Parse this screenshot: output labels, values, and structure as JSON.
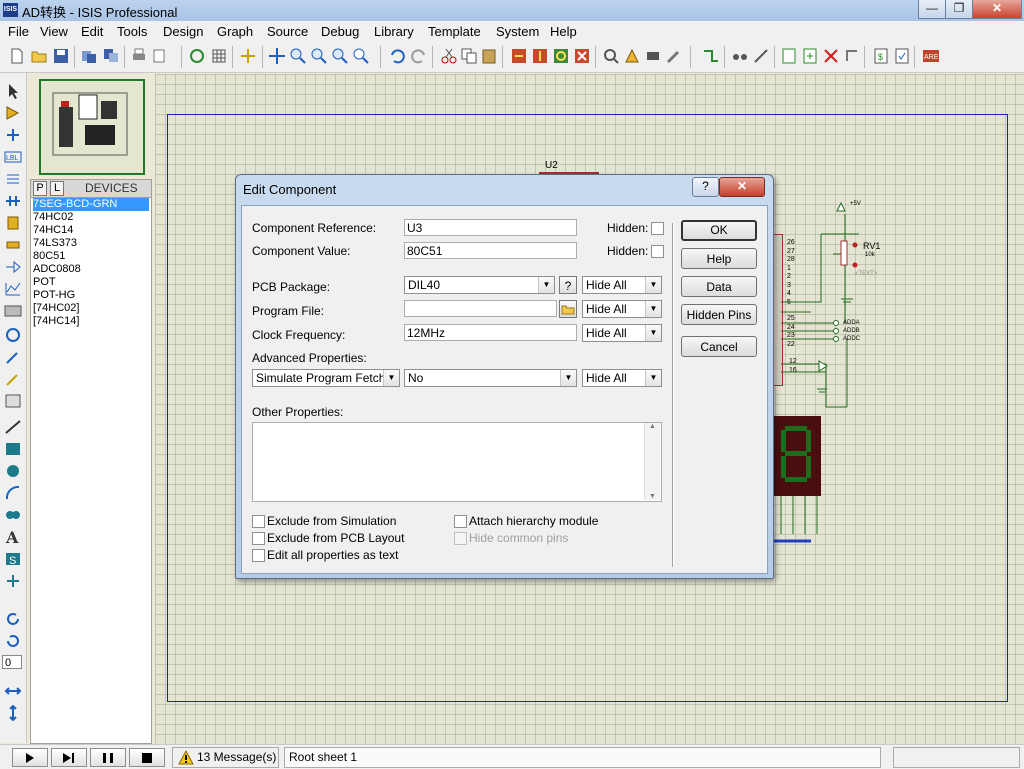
{
  "window": {
    "title": "AD转换 - ISIS Professional",
    "icon_label": "ISIS"
  },
  "menu": [
    "File",
    "View",
    "Edit",
    "Tools",
    "Design",
    "Graph",
    "Source",
    "Debug",
    "Library",
    "Template",
    "System",
    "Help"
  ],
  "devices_panel": {
    "tab_p": "P",
    "tab_l": "L",
    "title": "DEVICES",
    "items": [
      "7SEG-BCD-GRN",
      "74HC02",
      "74HC14",
      "74LS373",
      "80C51",
      "ADC0808",
      "POT",
      "POT-HG",
      "[74HC02]",
      "[74HC14]"
    ],
    "selected_index": 0
  },
  "rotation_value": "0",
  "schematic": {
    "u2_label": "U2",
    "pins_left": [
      "26",
      "27",
      "28",
      "1",
      "2",
      "3",
      "4",
      "5"
    ],
    "pins_mid": [
      "25",
      "24",
      "23",
      "22"
    ],
    "pins_low": [
      "12",
      "16"
    ],
    "net_labels": [
      "ADDA",
      "ADDB",
      "ADDC"
    ],
    "supply": "+5V",
    "pot_ref": "RV1",
    "pot_value": "10k",
    "pot_text": "<TEXT>"
  },
  "dialog": {
    "title": "Edit Component",
    "help_glyph": "?",
    "close_glyph": "✕",
    "component_reference": {
      "label": "Component Reference:",
      "value": "U3",
      "hidden_label": "Hidden:"
    },
    "component_value": {
      "label": "Component Value:",
      "value": "80C51",
      "hidden_label": "Hidden:"
    },
    "pcb_package": {
      "label": "PCB Package:",
      "value": "DIL40",
      "q_button": "?",
      "visibility": "Hide All"
    },
    "program_file": {
      "label": "Program File:",
      "value": "",
      "visibility": "Hide All"
    },
    "clock_frequency": {
      "label": "Clock Frequency:",
      "value": "12MHz",
      "visibility": "Hide All"
    },
    "advanced": {
      "label": "Advanced Properties:",
      "property": "Simulate Program Fetches",
      "value": "No",
      "visibility": "Hide All"
    },
    "other_properties": {
      "label": "Other Properties:",
      "value": ""
    },
    "checkboxes": {
      "exclude_simulation": "Exclude from Simulation",
      "exclude_pcb": "Exclude from PCB Layout",
      "edit_all_text": "Edit all properties as text",
      "attach_hierarchy": "Attach hierarchy module",
      "hide_common_pins": "Hide common pins"
    },
    "buttons": {
      "ok": "OK",
      "help": "Help",
      "data": "Data",
      "hidden_pins": "Hidden Pins",
      "cancel": "Cancel"
    }
  },
  "status": {
    "messages": "13 Message(s)",
    "sheet": "Root sheet 1"
  }
}
